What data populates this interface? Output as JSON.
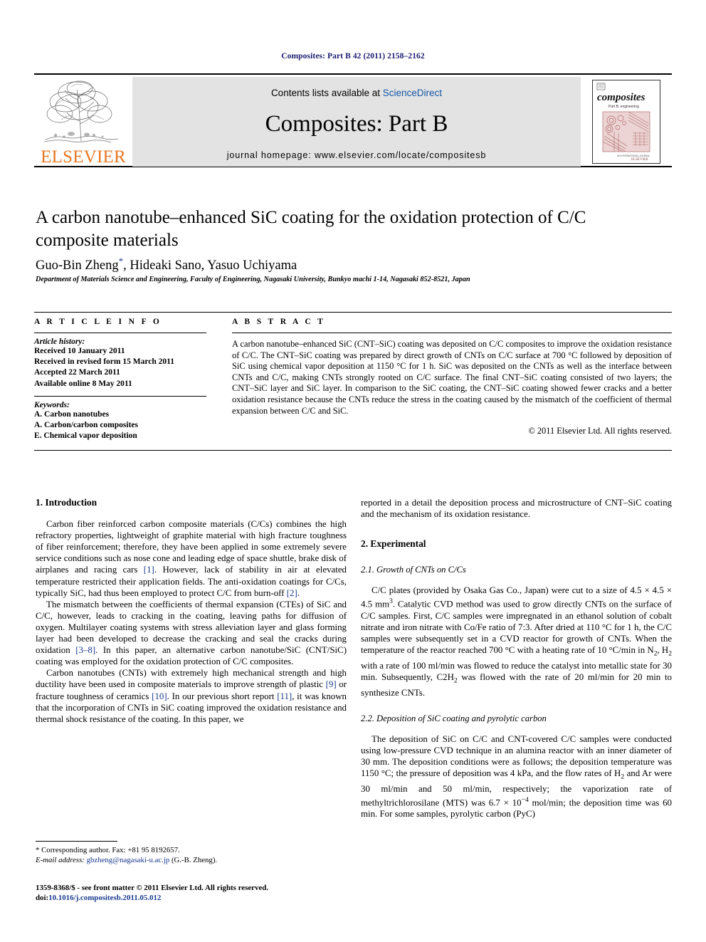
{
  "running_head": "Composites: Part B 42 (2011) 2158–2162",
  "banner": {
    "publisher_logo_text": "ELSEVIER",
    "contents_prefix": "Contents lists available at ",
    "contents_link": "ScienceDirect",
    "journal_title": "Composites: Part B",
    "homepage": "journal homepage: www.elsevier.com/locate/compositesb",
    "cover": {
      "title": "composites",
      "subtitle": "Part B: engineering",
      "footer": "ELSEVIER"
    }
  },
  "article": {
    "title": "A carbon nanotube–enhanced SiC coating for the oxidation protection of C/C composite materials",
    "authors": "Guo-Bin Zheng",
    "corresponding_marker": "*",
    "authors_rest": ", Hideaki Sano, Yasuo Uchiyama",
    "affiliation": "Department of Materials Science and Engineering, Faculty of Engineering, Nagasaki University, Bunkyo machi 1-14, Nagasaki 852-8521, Japan"
  },
  "info": {
    "heading": "A R T I C L E   I N F O",
    "history_label": "Article history:",
    "history": [
      "Received 10 January 2011",
      "Received in revised form 15 March 2011",
      "Accepted 22 March 2011",
      "Available online 8 May 2011"
    ],
    "keywords_label": "Keywords:",
    "keywords": [
      "A. Carbon nanotubes",
      "A. Carbon/carbon composites",
      "E. Chemical vapor deposition"
    ]
  },
  "abstract": {
    "heading": "A B S T R A C T",
    "text": "A carbon nanotube–enhanced SiC (CNT–SiC) coating was deposited on C/C composites to improve the oxidation resistance of C/C. The CNT–SiC coating was prepared by direct growth of CNTs on C/C surface at 700 °C followed by deposition of SiC using chemical vapor deposition at 1150 °C for 1 h. SiC was deposited on the CNTs as well as the interface between CNTs and C/C, making CNTs strongly rooted on C/C surface. The final CNT–SiC coating consisted of two layers; the CNT–SiC layer and SiC layer. In comparison to the SiC coating, the CNT–SiC coating showed fewer cracks and a better oxidation resistance because the CNTs reduce the stress in the coating caused by the mismatch of the coefficient of thermal expansion between C/C and SiC.",
    "copyright": "© 2011 Elsevier Ltd. All rights reserved."
  },
  "body": {
    "left": {
      "section1_heading": "1. Introduction",
      "p1_a": "Carbon fiber reinforced carbon composite materials (C/Cs) combines the high refractory properties, lightweight of graphite material with high fracture toughness of fiber reinforcement; therefore, they have been applied in some extremely severe service conditions such as nose cone and leading edge of space shuttle, brake disk of airplanes and racing cars ",
      "p1_ref1": "[1]",
      "p1_b": ". However, lack of stability in air at elevated temperature restricted their application fields. The anti-oxidation coatings for C/Cs, typically SiC, had thus been employed to protect C/C from burn-off ",
      "p1_ref2": "[2]",
      "p1_c": ".",
      "p2_a": "The mismatch between the coefficients of thermal expansion (CTEs) of SiC and C/C, however, leads to cracking in the coating, leaving paths for diffusion of oxygen. Multilayer coating systems with stress alleviation layer and glass forming layer had been developed to decrease the cracking and seal the cracks during oxidation ",
      "p2_ref1": "[3–8]",
      "p2_b": ". In this paper, an alternative carbon nanotube/SiC (CNT/SiC) coating was employed for the oxidation protection of C/C composites.",
      "p3_a": "Carbon nanotubes (CNTs) with extremely high mechanical strength and high ductility have been used in composite materials to improve strength of plastic ",
      "p3_ref1": "[9]",
      "p3_b": " or fracture toughness of ceramics ",
      "p3_ref2": "[10]",
      "p3_c": ". In our previous short report ",
      "p3_ref3": "[11]",
      "p3_d": ", it was known that the incorporation of CNTs in SiC coating improved the oxidation resistance and thermal shock resistance of the coating. In this paper, we"
    },
    "right": {
      "p_cont": "reported in a detail the deposition process and microstructure of CNT–SiC coating and the mechanism of its oxidation resistance.",
      "section2_heading": "2. Experimental",
      "sub21_heading": "2.1. Growth of CNTs on C/Cs",
      "p21": "C/C plates (provided by Osaka Gas Co., Japan) were cut to a size of 4.5 × 4.5 × 4.5 mm3. Catalytic CVD method was used to grow directly CNTs on the surface of C/C samples. First, C/C samples were impregnated in an ethanol solution of cobalt nitrate and iron nitrate with Co/Fe ratio of 7:3. After dried at 110 °C for 1 h, the C/C samples were subsequently set in a CVD reactor for growth of CNTs. When the temperature of the reactor reached 700 °C with a heating rate of 10 °C/min in N2, H2 with a rate of 100 ml/min was flowed to reduce the catalyst into metallic state for 30 min. Subsequently, C2H2 was flowed with the rate of 20 ml/min for 20 min to synthesize CNTs.",
      "sub22_heading": "2.2. Deposition of SiC coating and pyrolytic carbon",
      "p22": "The deposition of SiC on C/C and CNT-covered C/C samples were conducted using low-pressure CVD technique in an alumina reactor with an inner diameter of 30 mm. The deposition conditions were as follows; the deposition temperature was 1150 °C; the pressure of deposition was 4 kPa, and the flow rates of H2 and Ar were 30 ml/min and 50 ml/min, respectively; the vaporization rate of methyltrichlorosilane (MTS) was 6.7 × 10−4 mol/min; the deposition time was 60 min. For some samples, pyrolytic carbon (PyC)"
    }
  },
  "footnote": {
    "corresponding": "* Corresponding author. Fax: +81 95 8192657.",
    "email_label": "E-mail address:",
    "email": "gbzheng@nagasaki-u.ac.jp",
    "email_suffix": "(G.-B. Zheng)."
  },
  "footer": {
    "issn_line": "1359-8368/$ - see front matter © 2011 Elsevier Ltd. All rights reserved.",
    "doi_label": "doi:",
    "doi_value": "10.1016/j.compositesb.2011.05.012"
  },
  "colors": {
    "running_head": "#1a1a6e",
    "link": "#1557a5",
    "reference": "#1a3a8f",
    "elsevier_orange": "#E87722",
    "banner_grey": "#e3e3e3",
    "cover_pink": "#c47b7b"
  }
}
